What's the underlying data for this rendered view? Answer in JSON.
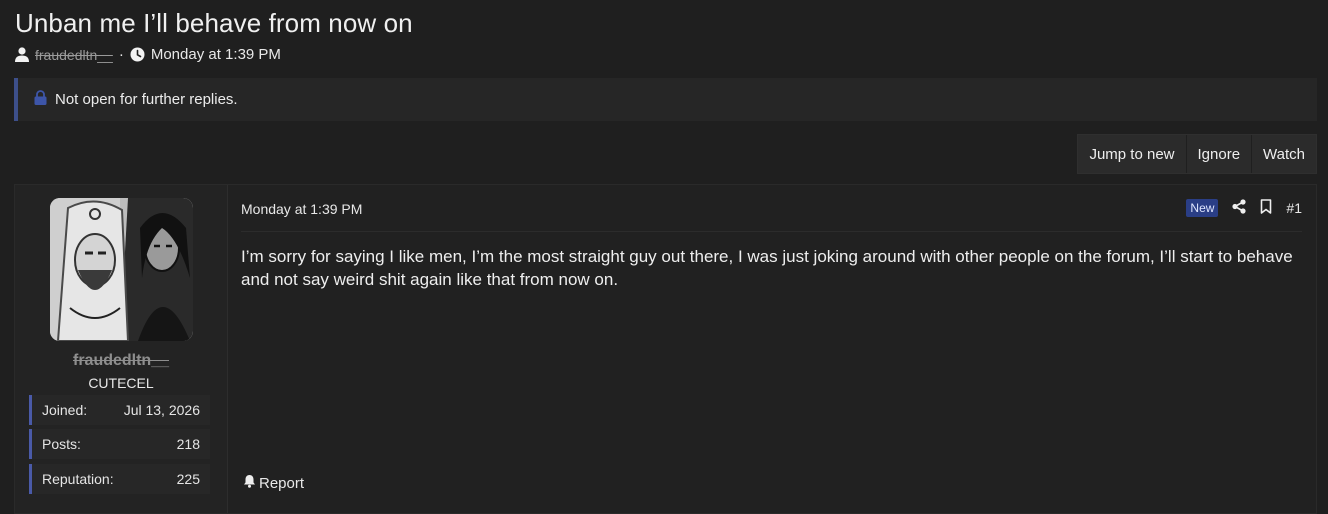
{
  "thread": {
    "title": "Unban me I’ll behave from now on",
    "author": "fraudedltn__",
    "separator": "·",
    "date": "Monday at 1:39 PM"
  },
  "notice": {
    "text": "Not open for further replies."
  },
  "thread_buttons": {
    "jump_to_new": "Jump to new",
    "ignore": "Ignore",
    "watch": "Watch"
  },
  "post": {
    "date": "Monday at 1:39 PM",
    "badge": "New",
    "number": "#1",
    "body": "I’m sorry for saying I like men, I’m the most straight guy out there, I was just joking around with other people on the forum, I’ll start to behave and not say weird shit again like that from now on.",
    "report_label": "Report"
  },
  "user": {
    "name": "fraudedltn__",
    "title": "CUTECEL",
    "stats": [
      {
        "label": "Joined:",
        "value": "Jul 13, 2026"
      },
      {
        "label": "Posts:",
        "value": "218"
      },
      {
        "label": "Reputation:",
        "value": "225"
      }
    ]
  },
  "colors": {
    "background": "#1f1f1f",
    "accent": "#3d4f8a",
    "badge_new": "#2a3e86"
  }
}
